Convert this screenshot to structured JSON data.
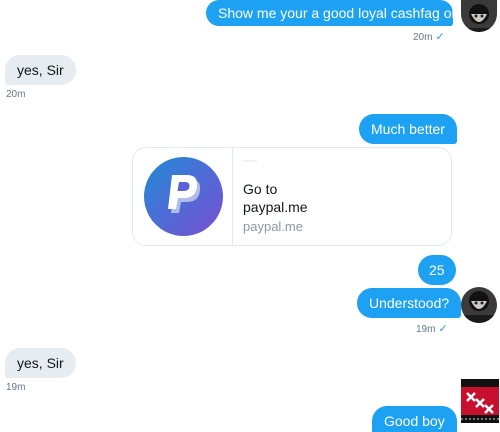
{
  "messages": {
    "m1": {
      "text": "Show me your a good loyal cashfag ok",
      "time": "20m"
    },
    "m2": {
      "text": "yes, Sir",
      "time": "20m"
    },
    "m3": {
      "text": "Much better"
    },
    "card": {
      "title_line1": "Go to",
      "title_line2": "paypal.me",
      "domain": "paypal.me"
    },
    "m4": {
      "text": "25"
    },
    "m5": {
      "text": "Understood?",
      "time": "19m"
    },
    "m6": {
      "text": "yes, Sir",
      "time": "19m"
    },
    "m7": {
      "text": "Good boy"
    }
  },
  "icons": {
    "read_receipt": "check-icon",
    "card_logo": "paypal-logo-icon"
  },
  "colors": {
    "outgoing_bubble": "#1da1f2",
    "incoming_bubble": "#e6ecf0",
    "timestamp": "#657786"
  }
}
